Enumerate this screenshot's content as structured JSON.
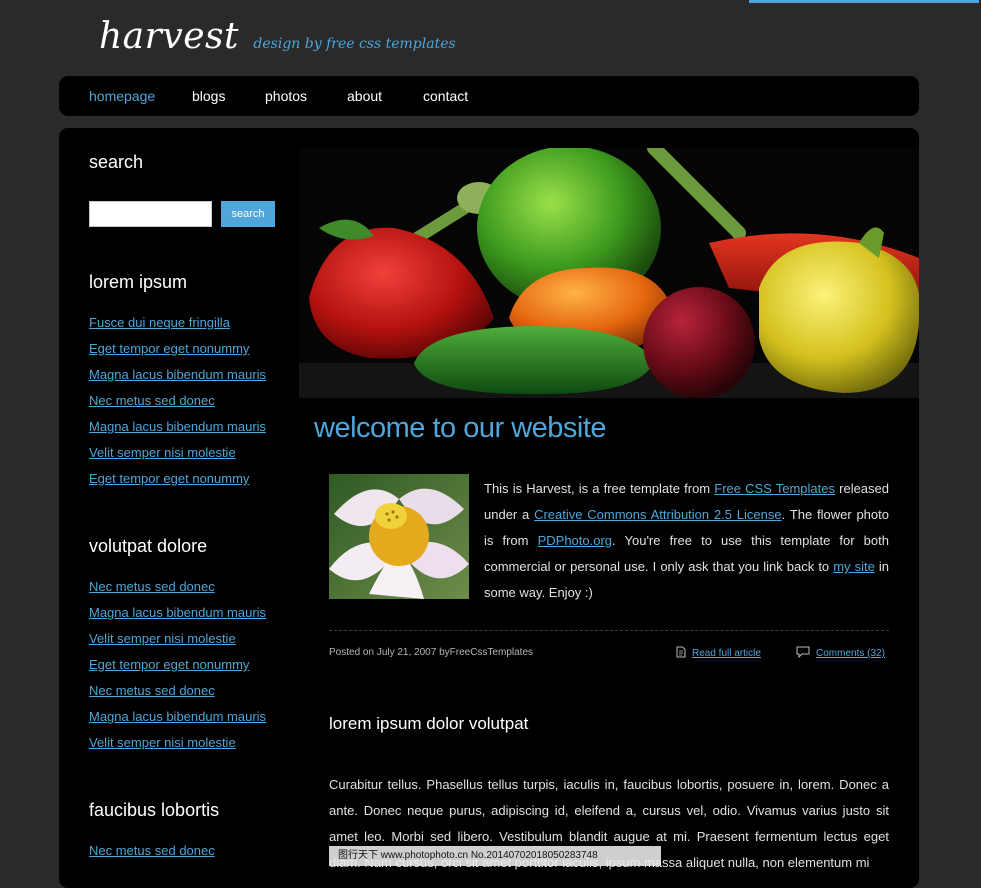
{
  "brand": {
    "name": "harvest",
    "tagline": "design by free css templates"
  },
  "nav": [
    "homepage",
    "blogs",
    "photos",
    "about",
    "contact"
  ],
  "sidebar": {
    "search_title": "search",
    "search_button": "search",
    "sections": [
      {
        "title": "lorem ipsum",
        "links": [
          "Fusce dui neque fringilla",
          "Eget tempor eget nonummy",
          "Magna lacus bibendum mauris",
          "Nec metus sed donec",
          "Magna lacus bibendum mauris",
          "Velit semper nisi molestie",
          "Eget tempor eget nonummy"
        ]
      },
      {
        "title": "volutpat dolore",
        "links": [
          "Nec metus sed donec",
          "Magna lacus bibendum mauris",
          "Velit semper nisi molestie",
          "Eget tempor eget nonummy",
          "Nec metus sed donec",
          "Magna lacus bibendum mauris",
          "Velit semper nisi molestie"
        ]
      },
      {
        "title": "faucibus lobortis",
        "links": [
          "Nec metus sed donec"
        ]
      }
    ]
  },
  "post": {
    "title": "welcome to our website",
    "p1": "This is Harvest, is a free template from ",
    "l1": "Free CSS Templates",
    "p2": " released under a ",
    "l2": "Creative Commons Attribution 2.5 License",
    "p3": ". The flower photo is from ",
    "l3": "PDPhoto.org",
    "p4": ". You're free to use this template for both commercial or personal use. I only ask that you link back to ",
    "l4": "my site",
    "p5": " in some way. Enjoy :)",
    "meta": "Posted on July 21, 2007 byFreeCssTemplates",
    "read_full": "Read full article",
    "comments": "Comments (32)"
  },
  "section2": {
    "title": "lorem ipsum dolor volutpat",
    "body": "Curabitur tellus. Phasellus tellus turpis, iaculis in, faucibus lobortis, posuere in, lorem. Donec a ante. Donec neque purus, adipiscing id, eleifend a, cursus vel, odio. Vivamus varius justo sit amet leo. Morbi sed libero. Vestibulum blandit augue at mi. Praesent fermentum lectus eget diam. Nam cursus, orci sit amet porttitor iaculis, ipsum massa aliquet nulla, non elementum mi"
  },
  "watermark": "图行天下 www.photophoto.cn No.20140702018050283748",
  "colors": {
    "accent": "#4ea6da",
    "page_bg": "#2a2a2a",
    "panel_bg": "#000000"
  }
}
